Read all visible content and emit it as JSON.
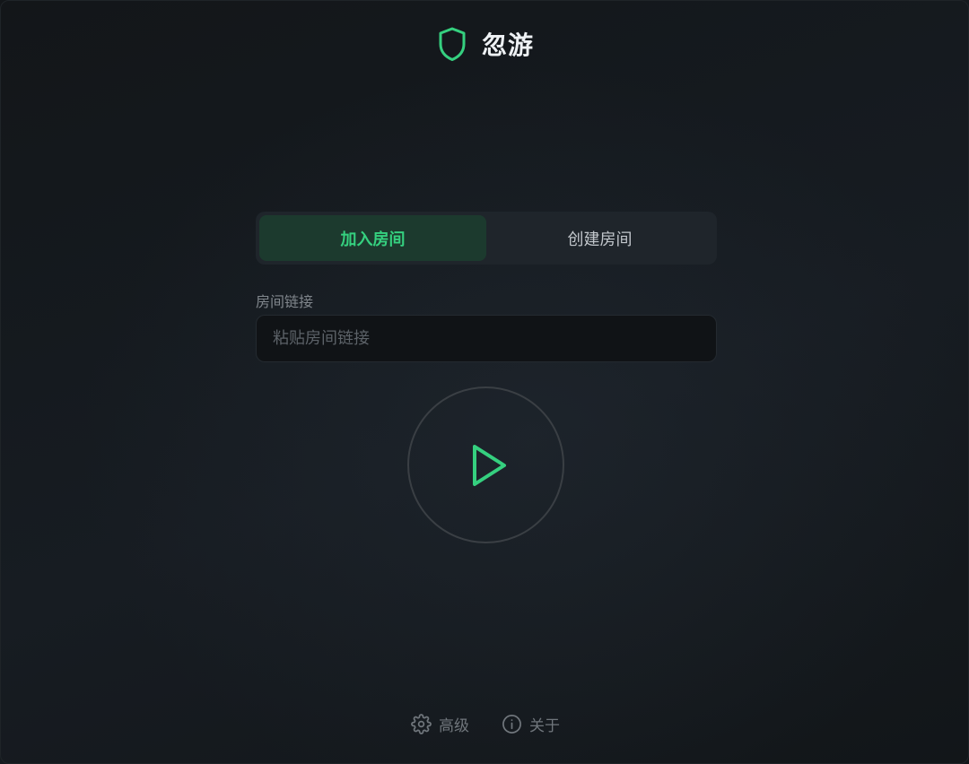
{
  "header": {
    "title": "忽游",
    "logo_icon": "shield-icon"
  },
  "tabs": [
    {
      "label": "加入房间",
      "active": true
    },
    {
      "label": "创建房间",
      "active": false
    }
  ],
  "join_form": {
    "label": "房间链接",
    "placeholder": "粘贴房间链接",
    "value": ""
  },
  "play_button": {
    "icon": "play-icon"
  },
  "footer": {
    "advanced_label": "高级",
    "advanced_icon": "gear-icon",
    "about_label": "关于",
    "about_icon": "info-icon"
  },
  "colors": {
    "accent": "#35d07f",
    "active_tab_bg": "#1c3a2e",
    "background": "#151a1f"
  }
}
